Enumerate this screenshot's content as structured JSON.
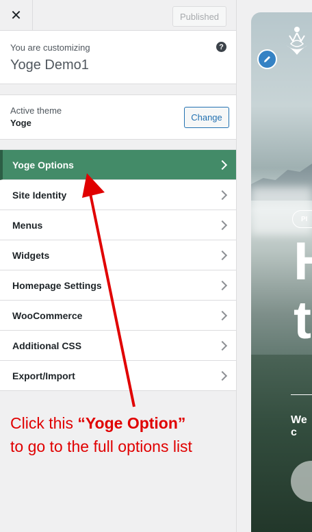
{
  "topbar": {
    "close_icon": "close-icon",
    "published_label": "Published"
  },
  "customizing": {
    "label": "You are customizing",
    "site_name": "Yoge Demo1",
    "help_icon": "help-icon"
  },
  "theme": {
    "label": "Active theme",
    "name": "Yoge",
    "change_label": "Change"
  },
  "menu": {
    "items": [
      {
        "label": "Yoge Options",
        "active": true
      },
      {
        "label": "Site Identity"
      },
      {
        "label": "Menus"
      },
      {
        "label": "Widgets"
      },
      {
        "label": "Homepage Settings"
      },
      {
        "label": "WooCommerce"
      },
      {
        "label": "Additional CSS"
      },
      {
        "label": "Export/Import"
      }
    ]
  },
  "preview": {
    "pill_text": "PI",
    "heading_line1": "H",
    "heading_line2": "t",
    "subtext": "We c",
    "edit_icon": "pencil-icon",
    "logo_icon": "yoga-lotus-logo-icon"
  },
  "annotation": {
    "prefix": "Click this ",
    "highlight": "“Yoge Option”",
    "line2": "to go to the full options list",
    "color": "#e00000"
  },
  "colors": {
    "active_menu_bg": "#438b68",
    "accent_blue": "#2271b1"
  }
}
